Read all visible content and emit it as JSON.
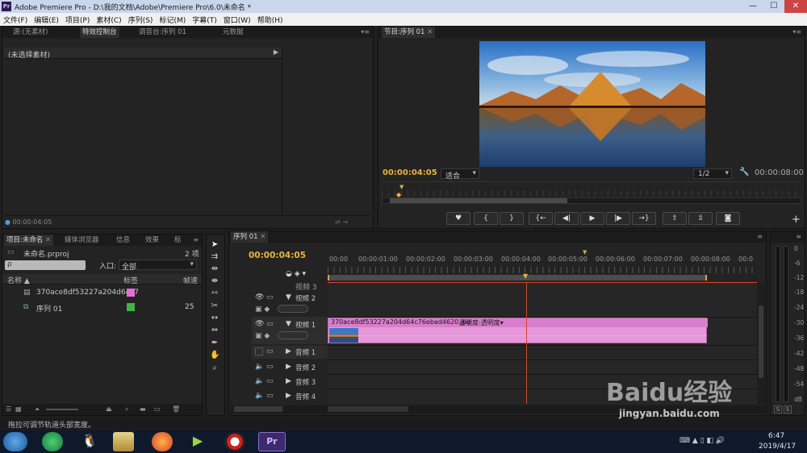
{
  "window": {
    "app_icon": "Pr",
    "title": "Adobe Premiere Pro - D:\\我的文档\\Adobe\\Premiere Pro\\6.0\\未命名 *",
    "min": "—",
    "max": "☐",
    "close": "✕"
  },
  "menu": [
    "文件(F)",
    "编辑(E)",
    "项目(P)",
    "素材(C)",
    "序列(S)",
    "标记(M)",
    "字幕(T)",
    "窗口(W)",
    "帮助(H)"
  ],
  "source_panel": {
    "tabs": [
      "源:(无素材)",
      "特效控制台",
      "调音台:序列 01",
      "元数据"
    ],
    "active_tab": 1,
    "header": "(未选择素材)",
    "timecode": "00:00:04:05"
  },
  "program_monitor": {
    "tab": "节目:序列 01",
    "timecode": "00:00:04:05",
    "fit": "适合",
    "resolution": "1/2",
    "duration": "00:00:08:00",
    "buttons": [
      "marker",
      "in-point",
      "out-point",
      "go-to-in",
      "step-back",
      "play",
      "step-forward",
      "go-to-out",
      "lift",
      "extract",
      "export-frame"
    ],
    "add": "+"
  },
  "project_panel": {
    "tabs": [
      "项目:未命名",
      "媒体浏览器",
      "信息",
      "效果",
      "标"
    ],
    "file": "未命名.prproj",
    "count": "2 项",
    "search_icon": "search-icon",
    "search_placeholder": "ρ",
    "entry_label": "入口:",
    "entry_value": "全部",
    "columns": [
      "名称",
      "标签",
      "帧速"
    ],
    "items": [
      {
        "name": "370ace8df53227a204d64c7",
        "label_color": "#e56fd6",
        "rate": ""
      },
      {
        "name": "序列 01",
        "label_color": "#3fb34f",
        "rate": "25"
      }
    ]
  },
  "timeline": {
    "tab": "序列 01",
    "timecode": "00:00:04:05",
    "ruler": [
      "00:00",
      "00:00:01:00",
      "00:00:02:00",
      "00:00:03:00",
      "00:00:04:00",
      "00:00:05:00",
      "00:00:06:00",
      "00:00:07:00",
      "00:00:08:00",
      "00:0"
    ],
    "tracks": {
      "v3": "视频 3",
      "v2": "视频 2",
      "v1": "视频 1",
      "a1": "音频 1",
      "a2": "音频 2",
      "a3": "音频 3",
      "a4": "音频 4"
    },
    "clip_name": "370ace8df53227a204d64c76ebad4620.jpg",
    "clip_fx": "透明度:透明度"
  },
  "audio_meter": {
    "labels": [
      "0",
      "-6",
      "-12",
      "-18",
      "-24",
      "-30",
      "-36",
      "-42",
      "-48",
      "-54",
      "dB"
    ],
    "solo": "S"
  },
  "status_bar": "拖拉可调节轨道头部宽度。",
  "taskbar": {
    "time": "6:47",
    "date": "2019/4/17",
    "pr_label": "Pr"
  },
  "watermark": {
    "logo": "Baidu经验",
    "url": "jingyan.baidu.com"
  },
  "colors": {
    "timecode": "#e8b53a",
    "clip": "#e598d9",
    "playhead": "#d9442e"
  }
}
